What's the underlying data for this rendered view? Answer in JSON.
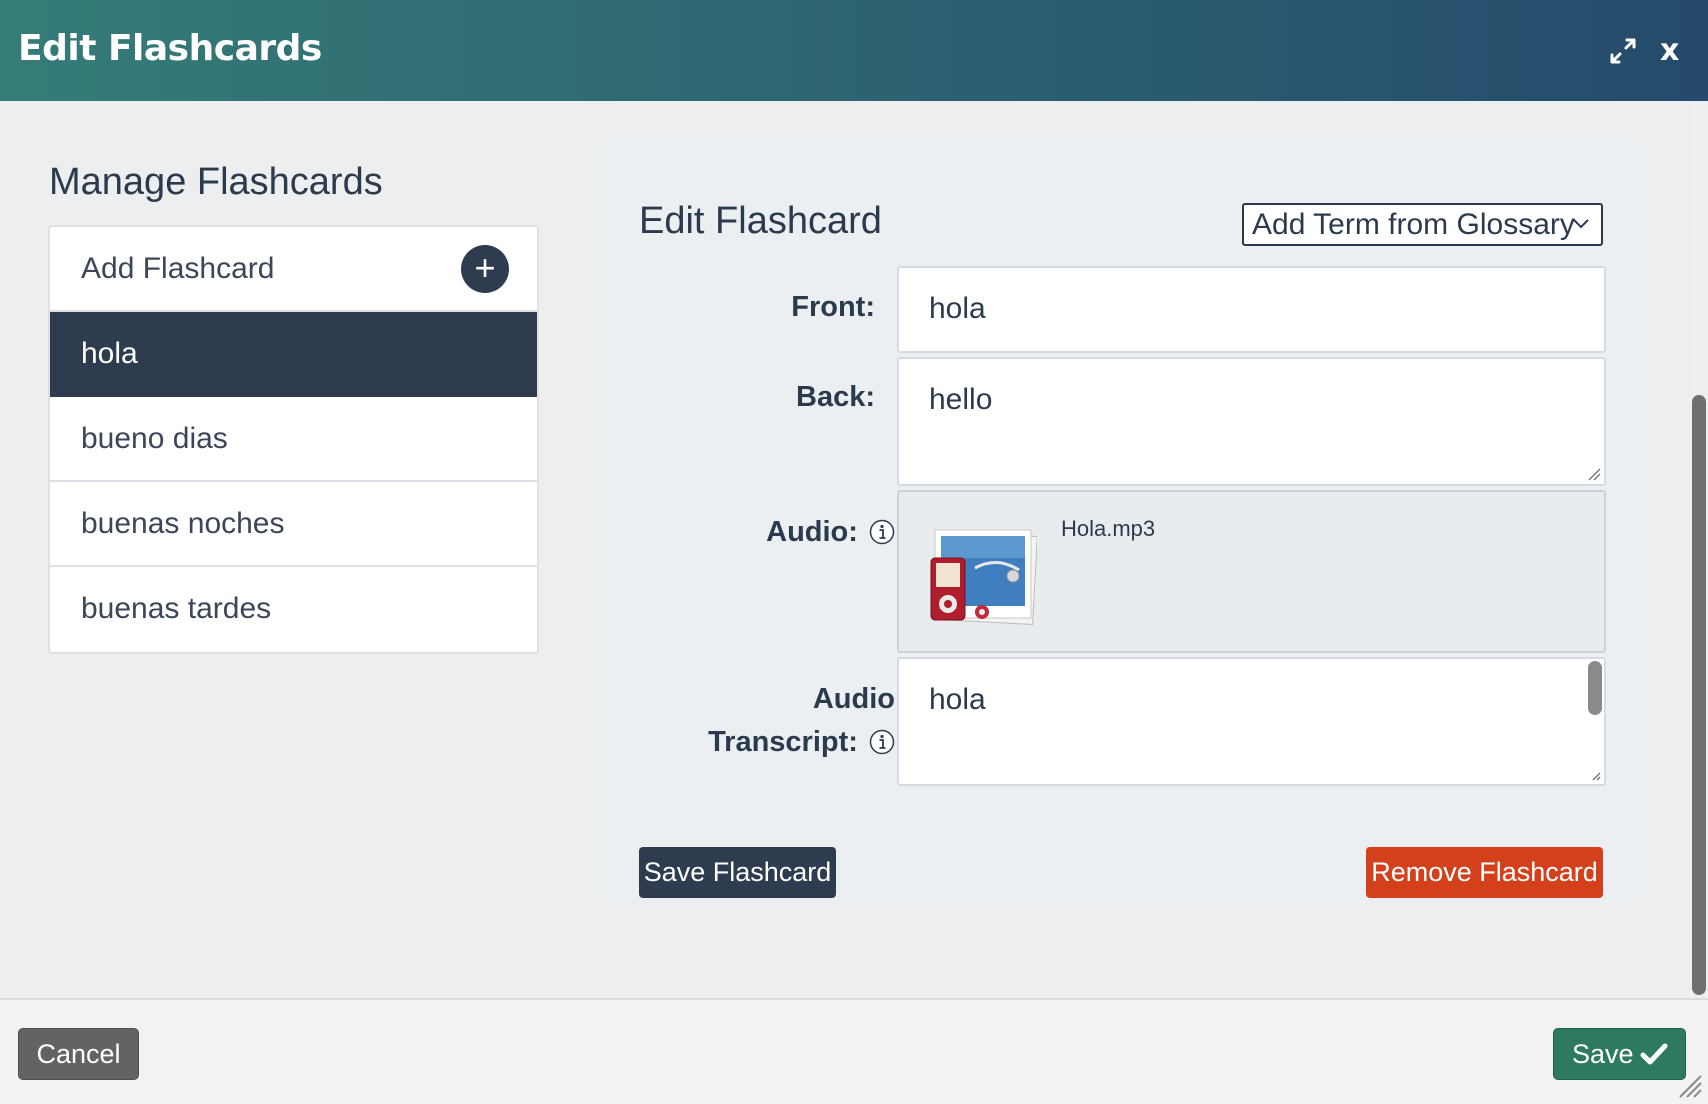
{
  "dialog": {
    "title": "Edit Flashcards",
    "close_label": "x",
    "expand_icon": "expand-arrows-icon"
  },
  "manage": {
    "heading": "Manage Flashcards",
    "add_label": "Add Flashcard",
    "add_icon": "+",
    "items": [
      "hola",
      "bueno dias",
      "buenas noches",
      "buenas tardes"
    ],
    "selected_index": 0
  },
  "editor": {
    "heading": "Edit Flashcard",
    "glossary_select": "Add Term from Glossary",
    "front_label": "Front:",
    "front_value": "hola",
    "back_label": "Back:",
    "back_value": "hello",
    "audio_label": "Audio:",
    "audio_file": "Hola.mp3",
    "transcript_label_line1": "Audio",
    "transcript_label_line2": "Transcript:",
    "transcript_value": "hola",
    "save_flashcard": "Save Flashcard",
    "remove_flashcard": "Remove Flashcard"
  },
  "footer": {
    "cancel": "Cancel",
    "save": "Save"
  },
  "colors": {
    "header_start": "#357c78",
    "header_end": "#254a6c",
    "primary_dark": "#2f3c50",
    "danger": "#d3401b",
    "save_green": "#2d7a61",
    "cancel_gray": "#636363"
  }
}
